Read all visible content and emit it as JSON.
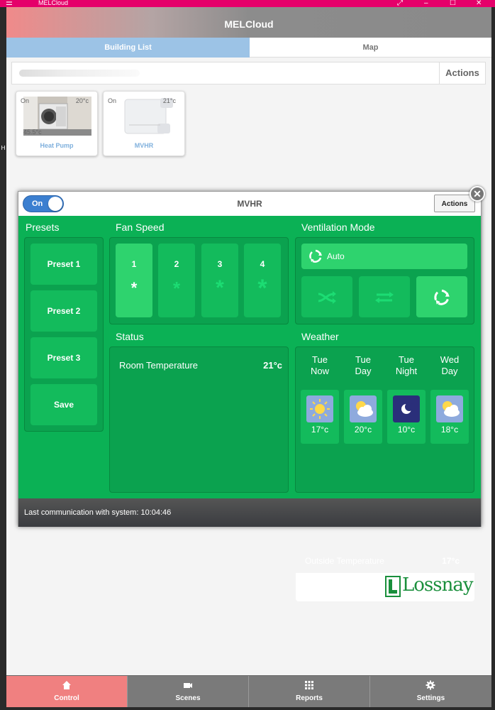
{
  "window": {
    "title": "MELCloud",
    "menu_icon": "hamburger-icon",
    "controls": [
      "⤢",
      "–",
      "☐",
      "✕"
    ]
  },
  "app": {
    "header_title": "MELCloud"
  },
  "tabs": [
    {
      "label": "Building List",
      "active": true
    },
    {
      "label": "Map",
      "active": false
    }
  ],
  "building_bar": {
    "actions_label": "Actions"
  },
  "devices": [
    {
      "label": "Heat Pump",
      "status": "On",
      "room_temp": "20°c",
      "water_temp": "45.5°c"
    },
    {
      "label": "MVHR",
      "status": "On",
      "room_temp": "21°c"
    }
  ],
  "modal": {
    "power_label": "On",
    "title": "MVHR",
    "actions_label": "Actions",
    "close_icon": "close-icon",
    "presets": {
      "heading": "Presets",
      "items": [
        "Preset 1",
        "Preset 2",
        "Preset 3"
      ],
      "save_label": "Save"
    },
    "fan_speed": {
      "heading": "Fan Speed",
      "levels": [
        "1",
        "2",
        "3",
        "4"
      ],
      "selected": "1"
    },
    "ventilation": {
      "heading": "Ventilation Mode",
      "current_label": "Auto",
      "modes": [
        "bypass-icon",
        "heat-recovery-icon",
        "auto-mode-icon"
      ],
      "selected": "auto-mode-icon"
    },
    "status": {
      "heading": "Status",
      "room_temp_label": "Room Temperature",
      "room_temp_value": "21°c"
    },
    "weather": {
      "heading": "Weather",
      "forecast": [
        {
          "day": "Tue",
          "period": "Now",
          "icon": "sun-icon",
          "temp": "17°c"
        },
        {
          "day": "Tue",
          "period": "Day",
          "icon": "partly-cloudy-icon",
          "temp": "20°c"
        },
        {
          "day": "Tue",
          "period": "Night",
          "icon": "moon-icon",
          "temp": "10°c"
        },
        {
          "day": "Wed",
          "period": "Day",
          "icon": "partly-cloudy-icon",
          "temp": "18°c"
        }
      ],
      "outside_label": "Outside Temperature",
      "outside_value": "17°c",
      "brand": "Lossnay"
    },
    "footer": "Last communication with system: 10:04:46"
  },
  "nav": [
    {
      "label": "Control",
      "icon": "home-icon",
      "active": true
    },
    {
      "label": "Scenes",
      "icon": "camera-icon",
      "active": false
    },
    {
      "label": "Reports",
      "icon": "grid-icon",
      "active": false
    },
    {
      "label": "Settings",
      "icon": "gear-icon",
      "active": false
    }
  ],
  "colors": {
    "accent_blue": "#3b7fd0",
    "panel_green": "#0bb155",
    "titlebar_pink": "#e5006a",
    "nav_active": "#f08080"
  }
}
